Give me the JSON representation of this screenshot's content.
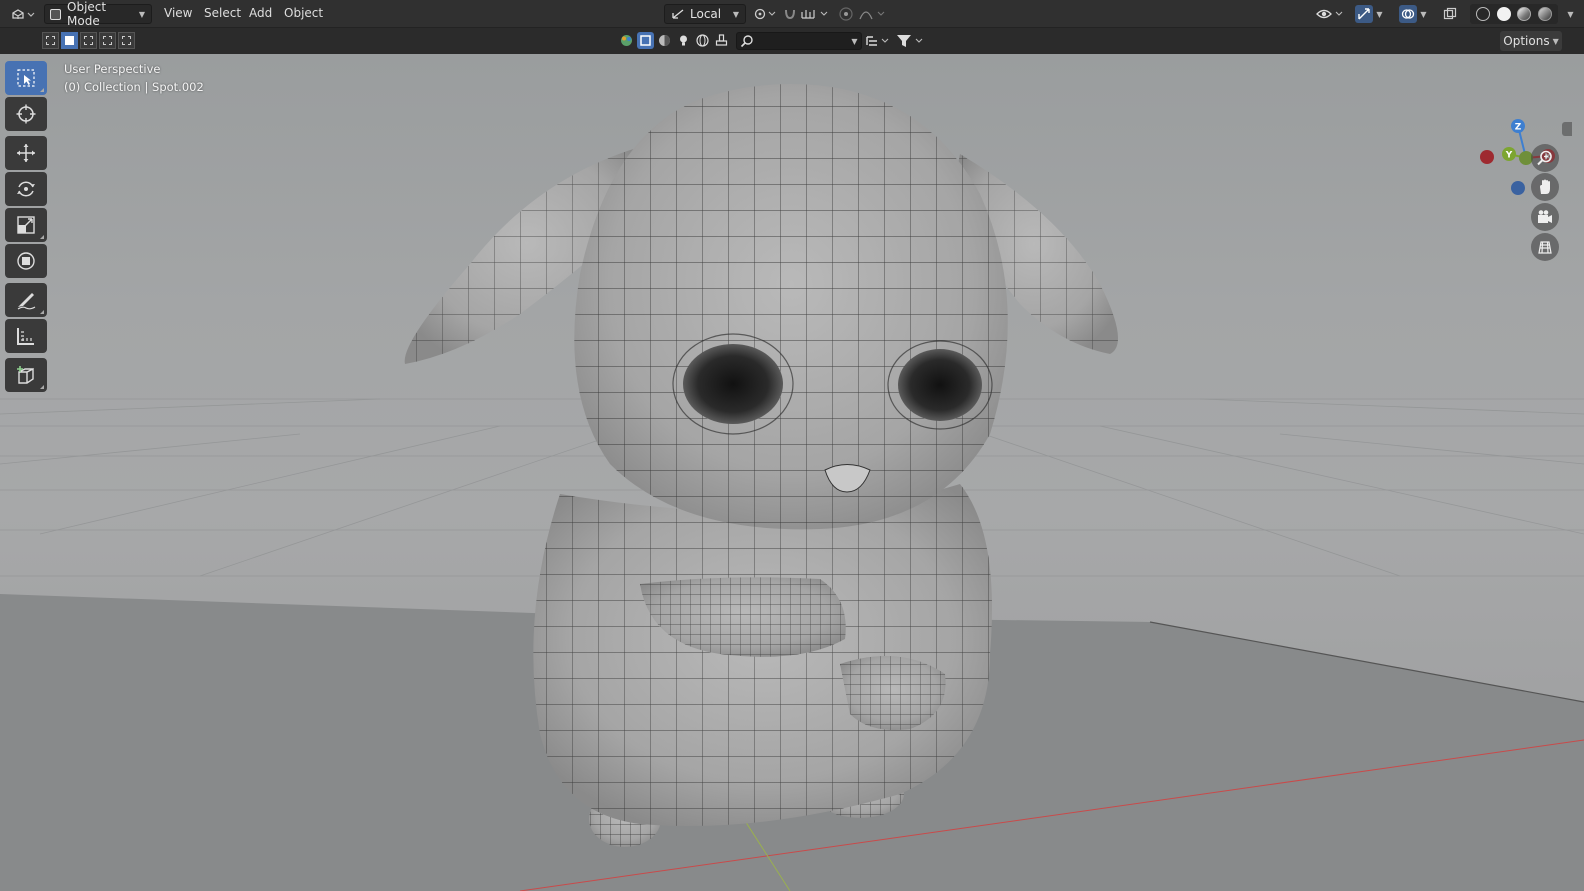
{
  "header": {
    "editor_type_icon": "viewport-editor-icon",
    "mode": "Object Mode",
    "menus": [
      "View",
      "Select",
      "Add",
      "Object"
    ],
    "transform_orientation": "Local",
    "icons": [
      "pivot-icon",
      "snap-icon",
      "snap-increment-icon",
      "proportional-edit-icon",
      "falloff-icon",
      "visibility-icon",
      "gizmo-icon",
      "overlay-icon",
      "xray-icon",
      "wireframe-shading-icon",
      "solid-shading-icon",
      "material-shading-icon",
      "rendered-shading-icon"
    ]
  },
  "toolheader": {
    "select_modes": [
      "select-new",
      "select-extend",
      "select-subtract",
      "select-difference",
      "select-intersect"
    ],
    "active_select_mode": 1,
    "search_placeholder": "",
    "options_label": "Options"
  },
  "viewport": {
    "view_name": "User Perspective",
    "collection_info": "(0) Collection | Spot.002"
  },
  "toolbar": {
    "tools": [
      "select-box-icon",
      "cursor-icon",
      "move-icon",
      "rotate-icon",
      "scale-icon",
      "transform-icon",
      "annotate-icon",
      "measure-icon",
      "add-cube-icon"
    ],
    "active_tool": 0
  },
  "gizmo": {
    "axes": [
      "X",
      "Y",
      "Z"
    ],
    "colors": {
      "x": "#e2343e",
      "y": "#7da531",
      "z": "#3e7fd0",
      "x_neg": "#9e2a30",
      "z_neg": "#3a62a0"
    }
  },
  "nav_buttons": [
    "zoom-icon",
    "pan-hand-icon",
    "camera-icon",
    "ortho-grid-icon"
  ]
}
